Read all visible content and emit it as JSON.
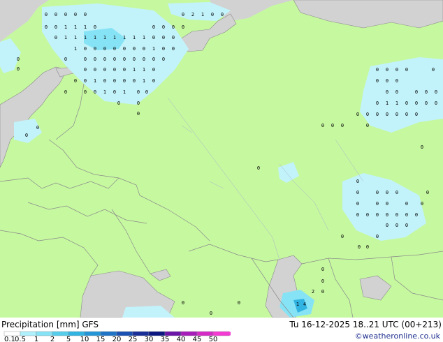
{
  "title": "Precipitation [mm] GFS",
  "datetime": "Tu 16-12-2025 18..21 UTC (00+213)",
  "credit": "©weatheronline.co.uk",
  "legend": {
    "labels": [
      "0.1",
      "0.5",
      "1",
      "2",
      "5",
      "10",
      "15",
      "20",
      "25",
      "30",
      "35",
      "40",
      "45",
      "50"
    ],
    "colors": [
      "#ffffff",
      "#aef0fb",
      "#86e3f5",
      "#56cdeb",
      "#32b4e3",
      "#2496d8",
      "#1f74c6",
      "#1a50b3",
      "#1a2f98",
      "#0c1880",
      "#6a14a8",
      "#a61db9",
      "#d42bc6",
      "#f43ad3"
    ]
  },
  "colors": {
    "land": "#c6f8a0",
    "sea": "#d2d2d2",
    "border": "#8a8a8a",
    "precip_light": "#c2f3fb",
    "precip_medium": "#86e3f5",
    "precip_heavy": "#32b4e3"
  }
}
